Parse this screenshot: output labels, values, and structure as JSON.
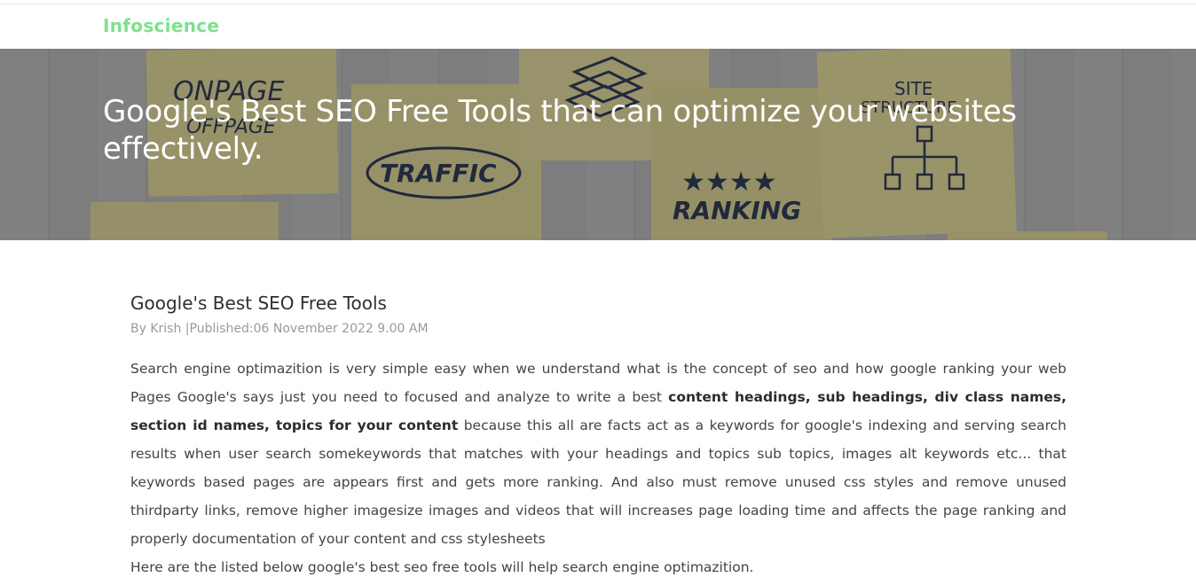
{
  "brand": "Infoscience",
  "hero": {
    "title": "Google's Best SEO Free Tools that can optimize your websites effectively.",
    "notes": [
      "ONPAGE",
      "OFFPAGE",
      "TRAFFIC",
      "RANKING",
      "SITE",
      "STRUCTURE"
    ]
  },
  "article": {
    "heading": "Google's Best SEO Free Tools",
    "meta": "By Krish |Published:06 November 2022 9.00 AM",
    "para_part1": "Search engine optimazition is very simple easy when we understand what is the concept of seo and how google ranking your web Pages Google's says just you need to focused and analyze to write a best ",
    "para_bold": "content headings, sub headings, div class names, section id names, topics for your content",
    "para_part2": " because this all are facts act as a keywords for google's indexing and serving search results when user search somekeywords that matches with your headings and topics sub topics, images alt keywords etc... that keywords based pages are appears first and gets more ranking. And also must remove unused css styles and remove unused thirdparty links, remove higher imagesize images and videos that will increases page loading time and affects the page ranking and properly documentation of your content and css stylesheets",
    "intro": "Here are the listed below google's best seo free tools will help search engine optimazition."
  }
}
